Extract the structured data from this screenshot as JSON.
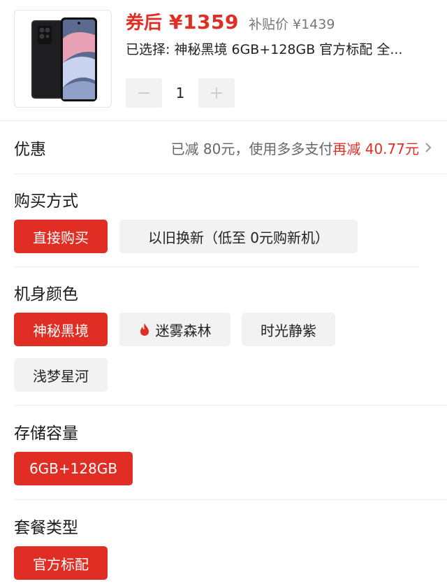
{
  "product": {
    "price_label": "券后",
    "price_value": "¥1359",
    "subsidy_price": "补贴价 ¥1439",
    "selected_text": "已选择: 神秘黑境 6GB+128GB 官方标配 全...",
    "quantity": "1"
  },
  "discount": {
    "title": "优惠",
    "grey_text": "已减 80元，使用多多支付",
    "red_text": "再减 40.77元"
  },
  "purchase_method": {
    "title": "购买方式",
    "options": [
      "直接购买",
      "以旧换新（低至 0元购新机）"
    ]
  },
  "color": {
    "title": "机身颜色",
    "options": [
      "神秘黑境",
      "迷雾森林",
      "时光静紫",
      "浅梦星河"
    ]
  },
  "storage": {
    "title": "存储容量",
    "options": [
      "6GB+128GB"
    ]
  },
  "package": {
    "title": "套餐类型",
    "options": [
      "官方标配"
    ]
  },
  "colors": {
    "accent": "#e02e24",
    "option_bg": "#f2f2f2",
    "divider": "#efefef"
  },
  "icons": [
    "product-phone-image",
    "minus-icon",
    "plus-icon",
    "chevron-right-icon",
    "flame-icon"
  ]
}
